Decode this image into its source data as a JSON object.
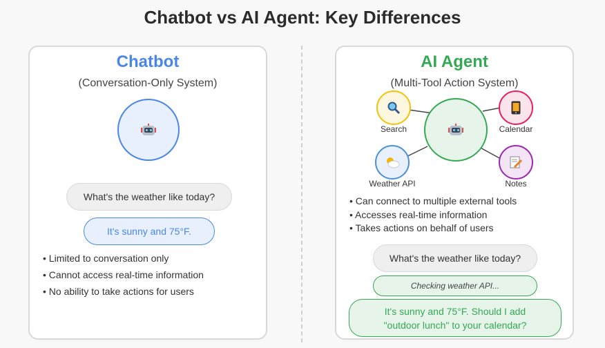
{
  "title": "Chatbot vs AI Agent: Key Differences",
  "chatbot": {
    "title": "Chatbot",
    "subtitle": "(Conversation-Only System)",
    "question": "What's the weather like today?",
    "answer": "It's sunny and 75°F.",
    "bullets": [
      "Limited to conversation only",
      "Cannot access real-time information",
      "No ability to take actions for users"
    ]
  },
  "agent": {
    "title": "AI Agent",
    "subtitle": "(Multi-Tool Action System)",
    "tools": {
      "search": "Search",
      "calendar": "Calendar",
      "weather": "Weather API",
      "notes": "Notes"
    },
    "bullets": [
      "Can connect to multiple external tools",
      "Accesses real-time information",
      "Takes actions on behalf of users"
    ],
    "question": "What's the weather like today?",
    "status": "Checking weather API...",
    "answer_line1": "It's sunny and 75°F. Should I add",
    "answer_line2": "\"outdoor lunch\" to your calendar?"
  },
  "colors": {
    "chatbot": "#4a86e8",
    "agent": "#34a853",
    "search": "#f4c20d",
    "calendar": "#e91e63",
    "weather": "#4a90d9",
    "notes": "#9c27b0"
  }
}
